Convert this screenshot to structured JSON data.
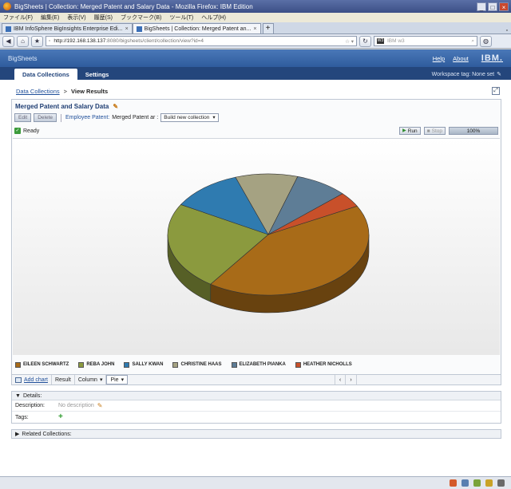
{
  "window": {
    "title": "BigSheets | Collection: Merged Patent and Salary Data - Mozilla Firefox: IBM Edition",
    "min": "_",
    "max": "□",
    "close": "×"
  },
  "menu": [
    "ファイル(F)",
    "編集(E)",
    "表示(V)",
    "履歴(S)",
    "ブックマーク(B)",
    "ツール(T)",
    "ヘルプ(H)"
  ],
  "tabs": [
    {
      "label": "IBM InfoSphere BigInsights Enterprise Edi..."
    },
    {
      "label": "BigSheets | Collection: Merged Patent an..."
    }
  ],
  "tab_close": "×",
  "new_tab": "+",
  "tab_list": "▫",
  "nav": {
    "url_host": "http://192.168.138.137",
    "url_path": ":8080/bigsheets/client/collection/view?id=4",
    "search_placeholder": "IBM w3",
    "search_engine": "W3"
  },
  "app": {
    "brand": "BigSheets",
    "help": "Help",
    "about": "About",
    "ibm": "IBM.",
    "tabs": [
      "Data Collections",
      "Settings"
    ],
    "workspace_tag": "Workspace tag: None set"
  },
  "breadcrumb": {
    "root": "Data Collections",
    "sep": ">",
    "current": "View Results"
  },
  "collection": {
    "title": "Merged Patent and Salary Data",
    "edit": "Edit",
    "delete": "Delete",
    "source_link": "Employee Patent:",
    "source_cur": "Merged Patent ar :",
    "build_dropdown": "Build new collection",
    "status": "Ready",
    "run": "Run",
    "stop": "Stop",
    "progress": "100%",
    "progress_fraction": 1.0
  },
  "chart_data": {
    "type": "pie",
    "categories": [
      "EILEEN SCHWARTZ",
      "REBA JOHN",
      "SALLY KWAN",
      "CHRISTINE HAAS",
      "ELIZABETH PIANKA",
      "HEATHER NICHOLLS"
    ],
    "values": [
      42.5,
      23.5,
      11.5,
      10.0,
      8.5,
      4.0
    ],
    "colors": [
      "#a86b18",
      "#8b9a3e",
      "#2f7bb0",
      "#a5a282",
      "#5e7d96",
      "#c8502a"
    ],
    "start_angle_deg": -28,
    "title": "",
    "legend": "bottom"
  },
  "chart_bar": {
    "add_chart": "Add chart",
    "result": "Result",
    "column": "Column",
    "pie": "Pie",
    "prev": "‹",
    "next": "›"
  },
  "details": {
    "header": "Details:",
    "description_label": "Description:",
    "description_value": "No description",
    "tags_label": "Tags:"
  },
  "related": "Related Collections:"
}
